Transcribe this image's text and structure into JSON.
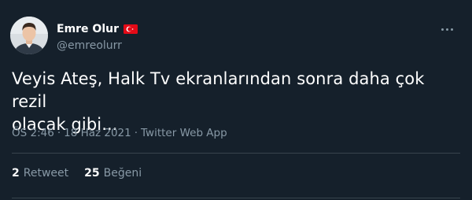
{
  "tweet": {
    "author": {
      "display_name": "Emre Olur",
      "handle": "@emreolurr",
      "flag_icon": "turkey-flag-icon",
      "avatar": "profile-photo"
    },
    "more_icon": "more-horizontal-icon",
    "text": "Veyis Ateş, Halk Tv ekranlarından sonra daha çok rezil\nolacak gibi...",
    "meta": {
      "time": "ÖS 2:46",
      "date": "18 Haz 2021",
      "source": "Twitter Web App",
      "separator": "·"
    },
    "stats": {
      "retweets_count": "2",
      "retweets_label": "Retweet",
      "likes_count": "25",
      "likes_label": "Beğeni"
    }
  },
  "colors": {
    "background": "#15202b",
    "primary_text": "#ffffff",
    "secondary_text": "#8899a6",
    "divider": "#38444d",
    "flag_red": "#e30a17"
  }
}
